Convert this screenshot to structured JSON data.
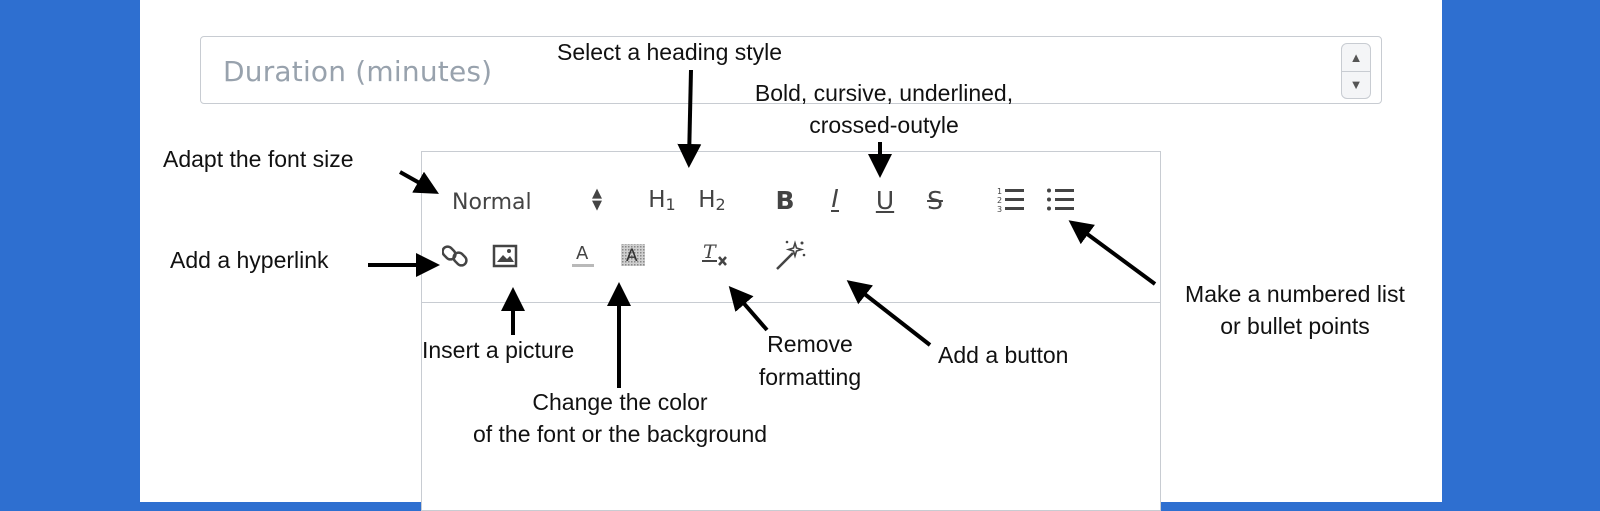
{
  "duration": {
    "placeholder": "Duration (minutes)",
    "spin_up_icon": "triangle-up-icon",
    "spin_down_icon": "triangle-down-icon"
  },
  "toolbar": {
    "font_size": "Normal",
    "h1": "H1",
    "h2": "H2",
    "bold": "B",
    "italic": "I",
    "underline": "U",
    "strike": "S",
    "icons": [
      "link-icon",
      "image-icon",
      "text-color-icon",
      "background-color-icon",
      "clear-formatting-icon",
      "magic-wand-icon",
      "ordered-list-icon",
      "bullet-list-icon"
    ]
  },
  "annotations": {
    "heading": "Select a heading style",
    "bold_line1": "Bold, cursive, underlined,",
    "bold_line2": "crossed-outyle",
    "font_size": "Adapt the font size",
    "hyperlink": "Add a hyperlink",
    "picture": "Insert a picture",
    "color_line1": "Change the color",
    "color_line2": "of the font or the background",
    "remove_line1": "Remove",
    "remove_line2": "formatting",
    "button": "Add a button",
    "list_line1": "Make a numbered list",
    "list_line2": "or bullet points"
  },
  "colors": {
    "background": "#2e6fd0",
    "panel": "#ffffff",
    "border": "#c8ccd2",
    "placeholder": "#98a2ad"
  }
}
